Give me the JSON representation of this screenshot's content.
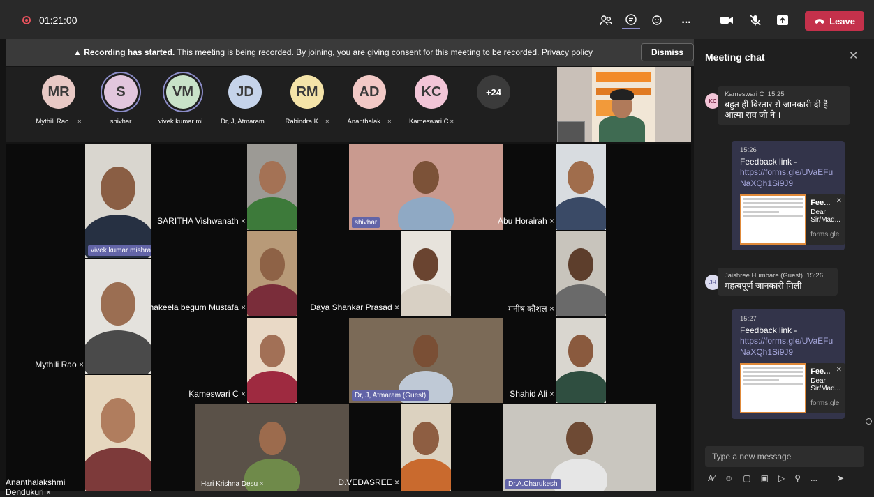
{
  "topbar": {
    "timer": "01:21:00",
    "more_label": "...",
    "leave_label": "Leave",
    "icons": [
      "people-icon",
      "chat-icon",
      "reactions-icon",
      "more-icon",
      "camera-icon",
      "mic-off-icon",
      "share-icon",
      "phone-icon"
    ]
  },
  "banner": {
    "bold": "Recording has started.",
    "text": "This meeting is being recorded. By joining, you are giving consent for this meeting to be recorded.",
    "link": "Privacy policy",
    "dismiss_label": "Dismiss"
  },
  "participants": [
    {
      "initials": "MR",
      "name": "Mythili Rao ...",
      "color": "#e8c9c5",
      "muted": true,
      "ring": false
    },
    {
      "initials": "S",
      "name": "shivhar",
      "color": "#e2c6dd",
      "muted": false,
      "ring": true
    },
    {
      "initials": "VM",
      "name": "vivek kumar mi...",
      "color": "#c8e2c8",
      "muted": false,
      "ring": true
    },
    {
      "initials": "JD",
      "name": "Dr, J, Atmaram ...",
      "color": "#c5d3ea",
      "muted": false,
      "ring": false
    },
    {
      "initials": "RM",
      "name": "Rabindra K...",
      "color": "#f4e3a8",
      "muted": true,
      "ring": false
    },
    {
      "initials": "AD",
      "name": "Ananthalak...",
      "color": "#f2c9c6",
      "muted": true,
      "ring": false
    },
    {
      "initials": "KC",
      "name": "Kameswari C",
      "color": "#f2c5d7",
      "muted": true,
      "ring": false
    }
  ],
  "overflow_count": "+24",
  "tiles": [
    {
      "name": "vivek kumar mishra",
      "highlight": true,
      "muted": false
    },
    {
      "name": "SARITHA Vishwanath",
      "highlight": false,
      "muted": true
    },
    {
      "name": "shivhar",
      "highlight": true,
      "muted": false
    },
    {
      "name": "Abu Horairah",
      "highlight": false,
      "muted": true
    },
    {
      "name": "Dr Shakeela begum Mustafa",
      "highlight": false,
      "muted": true
    },
    {
      "name": "Daya Shankar Prasad",
      "highlight": false,
      "muted": true
    },
    {
      "name": "मनीष कौशल",
      "highlight": false,
      "muted": true
    },
    {
      "name": "Mythili Rao",
      "highlight": false,
      "muted": true
    },
    {
      "name": "Kameswari C",
      "highlight": false,
      "muted": true
    },
    {
      "name": "Dr, J, Atmaram (Guest)",
      "highlight": true,
      "muted": false
    },
    {
      "name": "Shahid Ali",
      "highlight": false,
      "muted": true
    },
    {
      "name": "Ananthalakshmi Dendukuri",
      "highlight": false,
      "muted": true
    },
    {
      "name": "Hari Krishna Desu",
      "highlight": false,
      "muted": true
    },
    {
      "name": "D.VEDASREE",
      "highlight": false,
      "muted": true
    },
    {
      "name": "Dr.A.Charukesh",
      "highlight": true,
      "muted": false
    }
  ],
  "chat": {
    "title": "Meeting chat",
    "messages": [
      {
        "initials": "KC",
        "author": "Kameswari C",
        "time": "15:25",
        "text": "बहुत ही विस्तार से जानकारी दी है आत्मा राव जी ने ।"
      },
      {
        "time": "15:26",
        "text": "Feedback link -",
        "link": "https://forms.gle/UVaEFuNaXQh1Si9J9",
        "card_title": "Fee...",
        "card_desc": "Dear Sir/Mad...",
        "card_site": "forms.gle"
      },
      {
        "initials": "JH",
        "author": "Jaishree Humbare (Guest)",
        "time": "15:26",
        "text": "महत्वपूर्ण जानकारी मिली"
      },
      {
        "time": "15:27",
        "text": "Feedback link -",
        "link": "https://forms.gle/UVaEFuNaXQh1Si9J9",
        "card_title": "Fee...",
        "card_desc": "Dear Sir/Mad...",
        "card_site": "forms.gle"
      }
    ],
    "compose_placeholder": "Type a new message",
    "compose_more": "..."
  }
}
